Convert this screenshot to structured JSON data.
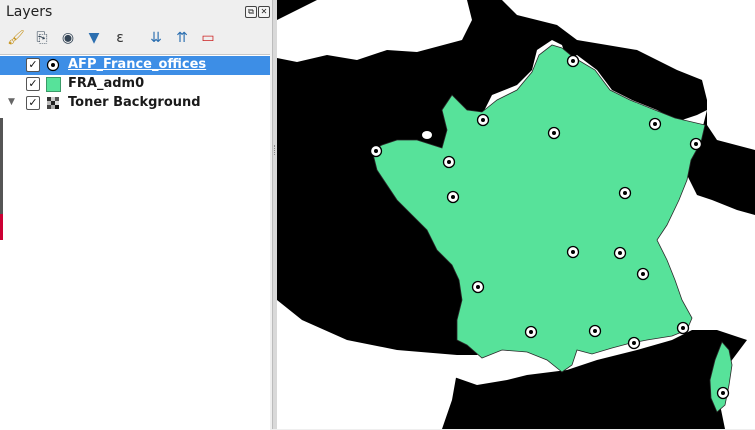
{
  "panel": {
    "title": "Layers",
    "float_btn": "⧉",
    "close_btn": "✕"
  },
  "toolbar": {
    "icons": [
      "style-brush-icon",
      "add-group-icon",
      "visibility-eye-icon",
      "filter-icon",
      "expression-filter-icon",
      "expand-all-icon",
      "collapse-all-icon",
      "remove-layer-icon"
    ],
    "glyphs": [
      "🖌",
      "⎘",
      "◉",
      "▼",
      "ε",
      "⇊",
      "⇈",
      "▭"
    ]
  },
  "layers": [
    {
      "name": "AFP_France_offices",
      "checked": true,
      "selected": true,
      "icon": "point-symbol-icon"
    },
    {
      "name": "FRA_adm0",
      "checked": true,
      "selected": false,
      "icon": "polygon-fill-icon",
      "color": "#57e29a"
    },
    {
      "name": "Toner Background",
      "checked": true,
      "selected": false,
      "icon": "raster-tile-icon",
      "expandable": true
    }
  ],
  "checkmark": "✓",
  "map": {
    "land_color": "#ffffff",
    "sea_color": "#000000",
    "france_fill": "#57e29a",
    "office_point_count": 20
  }
}
